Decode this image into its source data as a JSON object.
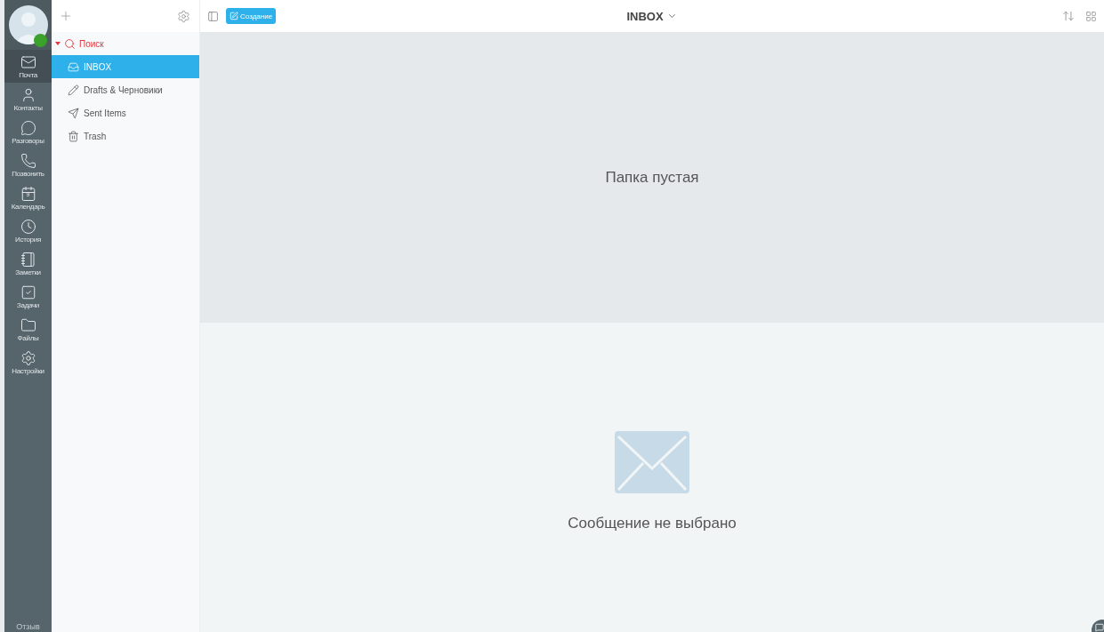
{
  "rail": {
    "items": [
      {
        "kind": "mail",
        "label": "Почта",
        "selected": true
      },
      {
        "kind": "contacts",
        "label": "Контакты",
        "selected": false
      },
      {
        "kind": "chats",
        "label": "Разговоры",
        "selected": false
      },
      {
        "kind": "call",
        "label": "Позвонить",
        "selected": false
      },
      {
        "kind": "calendar",
        "label": "Календарь",
        "selected": false,
        "day": "9"
      },
      {
        "kind": "history",
        "label": "История",
        "selected": false
      },
      {
        "kind": "notes",
        "label": "Заметки",
        "selected": false
      },
      {
        "kind": "tasks",
        "label": "Задачи",
        "selected": false
      },
      {
        "kind": "files",
        "label": "Файлы",
        "selected": false
      },
      {
        "kind": "settings",
        "label": "Настройки",
        "selected": false
      }
    ],
    "feedback": "Отзыв",
    "online": true
  },
  "folders": {
    "search": "Поиск",
    "expanded": true,
    "items": [
      {
        "kind": "inbox",
        "label": "INBOX",
        "selected": true
      },
      {
        "kind": "drafts",
        "label": "Drafts & Черновики",
        "selected": false
      },
      {
        "kind": "sent",
        "label": "Sent Items",
        "selected": false
      },
      {
        "kind": "trash",
        "label": "Trash",
        "selected": false
      }
    ]
  },
  "toolbar": {
    "compose": "Создание",
    "title": "INBOX"
  },
  "list": {
    "empty": "Папка пустая"
  },
  "preview": {
    "empty": "Сообщение не выбрано"
  }
}
